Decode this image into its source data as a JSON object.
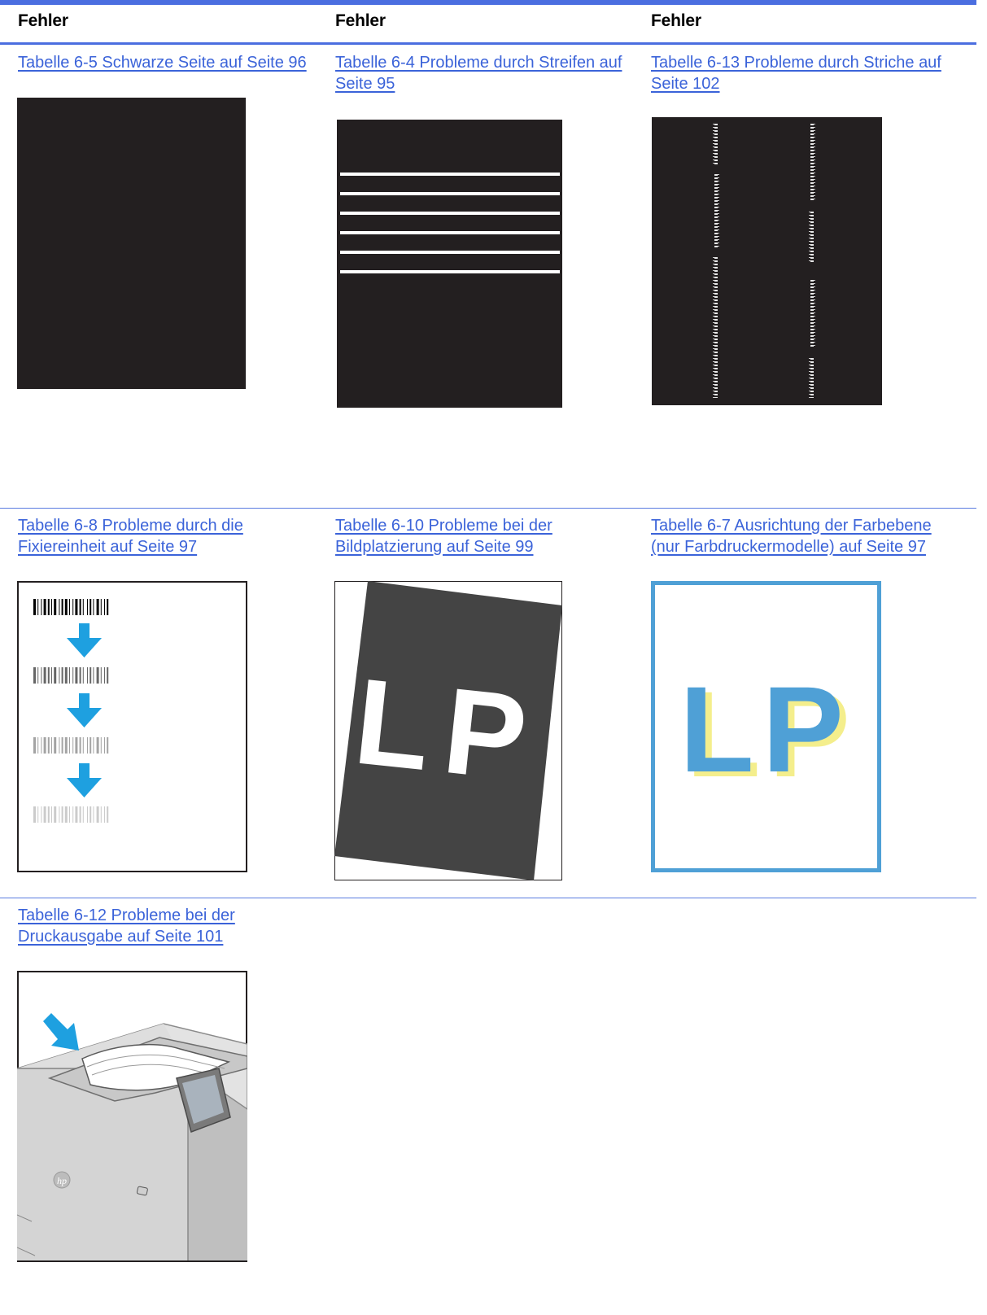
{
  "header": {
    "col1": "Fehler",
    "col2": "Fehler",
    "col3": "Fehler"
  },
  "links": {
    "black_page": [
      "Tabelle 6-5 Schwarze Seite auf Seite 96"
    ],
    "banding": [
      "Tabelle 6-4 Probleme durch Streifen auf",
      "Seite 95"
    ],
    "streaks": [
      "Tabelle 6-13 Probleme durch Striche auf",
      "Seite 102"
    ],
    "fuser": [
      "Tabelle 6-8 Probleme durch die",
      "Fixiereinheit auf Seite 97"
    ],
    "image_placement": [
      "Tabelle 6-10 Probleme bei der",
      "Bildplatzierung auf Seite 99"
    ],
    "color_registration": [
      "Tabelle 6-7 Ausrichtung der Farbebene",
      "(nur Farbdruckermodelle) auf Seite 97"
    ],
    "output": [
      "Tabelle 6-12 Probleme bei der",
      "Druckausgabe auf Seite 101"
    ]
  },
  "figures": {
    "skewed_page_text": "LP",
    "registration_text": "LP"
  },
  "colors": {
    "accent_rule": "#4b6ee0",
    "link": "#3b63d9",
    "dark_page": "#231f20",
    "arrow_blue": "#1ea0e0",
    "registration_blue": "#4fa0d6",
    "registration_yellow": "#f4ee8c"
  }
}
